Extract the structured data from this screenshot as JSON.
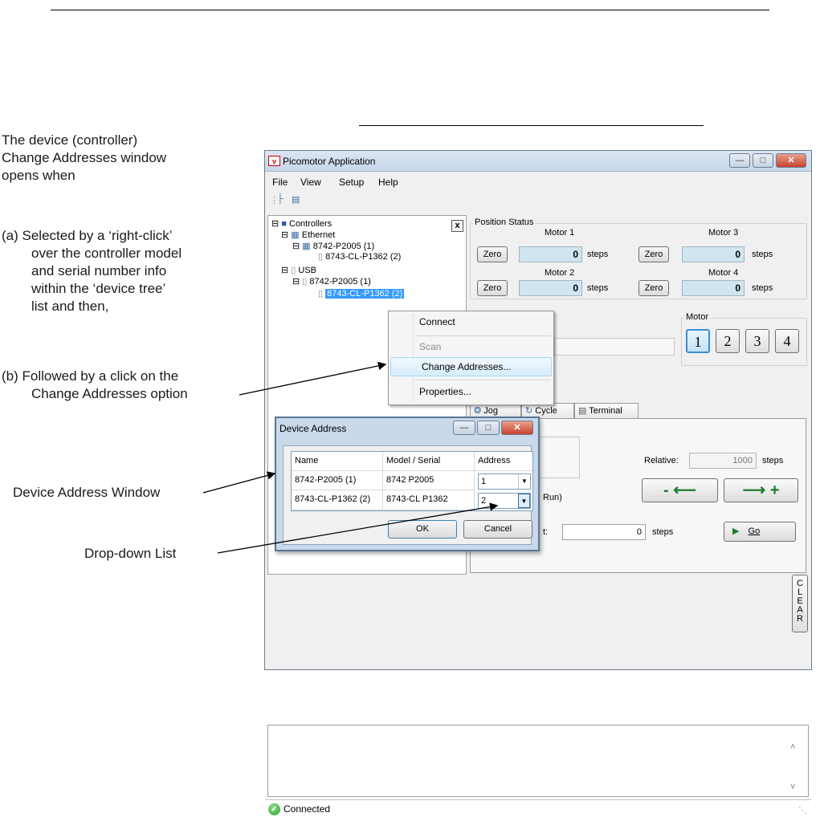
{
  "document": {
    "intro_lines": [
      "The device (controller)",
      "Change Addresses window",
      "opens when"
    ],
    "step_a_lines": [
      "(a)  Selected by a ‘right-click’",
      "over the controller model",
      "and serial number info",
      "within the ‘device tree’",
      "list and then,"
    ],
    "step_b_lines": [
      "(b)  Followed by a click on the",
      "Change Addresses option"
    ],
    "callout_device_address_window": "Device Address Window",
    "callout_dropdown_list": "Drop-down  List"
  },
  "app": {
    "title": "Picomotor Application",
    "logo_text": "ν",
    "window_buttons": {
      "minimize": "—",
      "maximize": "□",
      "close": "✕"
    },
    "menu": [
      "File",
      "View",
      "Setup",
      "Help"
    ],
    "tree": {
      "close_glyph": "x",
      "root": "Controllers",
      "ethernet": "Ethernet",
      "eth_controller": "8742-P2005 (1)",
      "eth_device": "8743-CL-P1362 (2)",
      "usb": "USB",
      "usb_controller": "8742-P2005 (1)",
      "usb_device_selected": "8743-CL-P1362 (2)"
    },
    "position_status": {
      "label": "Position Status",
      "zero_label": "Zero",
      "units": "steps",
      "motors": [
        {
          "name": "Motor 1",
          "value": "0"
        },
        {
          "name": "Motor 3",
          "value": "0"
        },
        {
          "name": "Motor 2",
          "value": "0"
        },
        {
          "name": "Motor 4",
          "value": "0"
        }
      ]
    },
    "motor_select": {
      "label": "Motor",
      "buttons": [
        "1",
        "2",
        "3",
        "4"
      ],
      "active": "1"
    },
    "context_menu": {
      "items": [
        "Connect",
        "Scan",
        "Change Addresses...",
        "Properties..."
      ],
      "disabled": "Scan",
      "highlighted": "Change Addresses..."
    },
    "tabs": [
      "Jog",
      "Cycle",
      "Terminal"
    ],
    "jog": {
      "relative_label": "Relative:",
      "relative_value": "1000",
      "relative_units": "steps",
      "minus_label": "- ⟵",
      "plus_label": "⟶ +",
      "run_label_partial": "Run)",
      "target_label_partial": "t:",
      "target_value": "0",
      "target_units": "steps",
      "go_label": "Go"
    },
    "clear_label": [
      "C",
      "L",
      "E",
      "A",
      "R"
    ],
    "status": "Connected"
  },
  "device_address_dialog": {
    "title": "Device Address",
    "columns": [
      "Name",
      "Model / Serial",
      "Address"
    ],
    "rows": [
      {
        "name": "8742-P2005 (1)",
        "model": "8742 P2005",
        "address": "1"
      },
      {
        "name": "8743-CL-P1362 (2)",
        "model": "8743-CL P1362",
        "address": "2"
      }
    ],
    "ok_label": "OK",
    "cancel_label": "Cancel"
  }
}
